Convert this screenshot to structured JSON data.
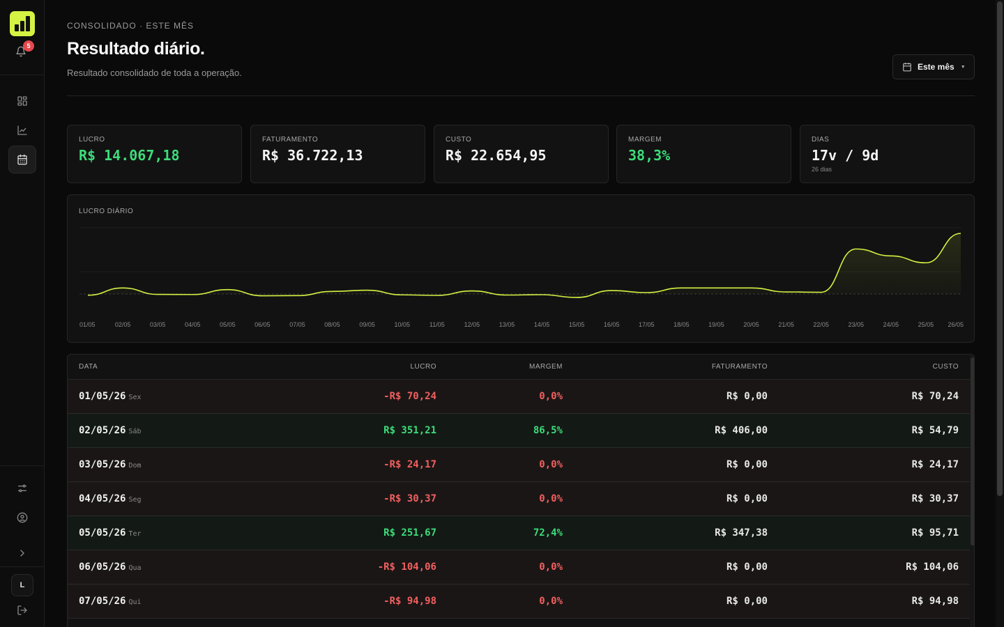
{
  "sidebar": {
    "notifications_count": "5",
    "avatar_initial": "L"
  },
  "header": {
    "eyebrow": "CONSOLIDADO · ESTE MÊS",
    "title": "Resultado diário.",
    "subtitle": "Resultado consolidado de toda a operação.",
    "period_button": "Este mês"
  },
  "kpis": [
    {
      "label": "LUCRO",
      "value": "R$ 14.067,18",
      "accent": "#3ddc7a"
    },
    {
      "label": "FATURAMENTO",
      "value": "R$ 36.722,13"
    },
    {
      "label": "CUSTO",
      "value": "R$ 22.654,95"
    },
    {
      "label": "MARGEM",
      "value": "38,3%",
      "accent": "#3ddc7a"
    },
    {
      "label": "DIAS",
      "value": "17v / 9d",
      "sub": "26 dias"
    }
  ],
  "chart_title": "LUCRO DIÁRIO",
  "chart_data": {
    "type": "area",
    "title": "LUCRO DIÁRIO",
    "x": [
      "01/05",
      "02/05",
      "03/05",
      "04/05",
      "05/05",
      "06/05",
      "07/05",
      "08/05",
      "09/05",
      "10/05",
      "11/05",
      "12/05",
      "13/05",
      "14/05",
      "15/05",
      "16/05",
      "17/05",
      "18/05",
      "19/05",
      "20/05",
      "21/05",
      "22/05",
      "23/05",
      "24/05",
      "25/05",
      "26/05"
    ],
    "series": [
      {
        "values": [
          -70,
          351,
          -24,
          -30,
          252,
          -104,
          -95,
          150,
          220,
          -50,
          -80,
          180,
          -60,
          -40,
          -200,
          200,
          80,
          350,
          350,
          350,
          120,
          100,
          2600,
          2200,
          1800,
          3500
        ]
      }
    ],
    "baseline": 0,
    "color": "#d4f243",
    "grid": true
  },
  "table": {
    "headers": {
      "data": "DATA",
      "lucro": "LUCRO",
      "margem": "MARGEM",
      "faturamento": "FATURAMENTO",
      "custo": "CUSTO"
    },
    "rows": [
      {
        "date": "01/05/26",
        "dow": "Sex",
        "lucro": "-R$ 70,24",
        "margem": "0,0%",
        "faturamento": "R$ 0,00",
        "custo": "R$ 70,24",
        "positive": false
      },
      {
        "date": "02/05/26",
        "dow": "Sáb",
        "lucro": "R$ 351,21",
        "margem": "86,5%",
        "faturamento": "R$ 406,00",
        "custo": "R$ 54,79",
        "positive": true
      },
      {
        "date": "03/05/26",
        "dow": "Dom",
        "lucro": "-R$ 24,17",
        "margem": "0,0%",
        "faturamento": "R$ 0,00",
        "custo": "R$ 24,17",
        "positive": false
      },
      {
        "date": "04/05/26",
        "dow": "Seg",
        "lucro": "-R$ 30,37",
        "margem": "0,0%",
        "faturamento": "R$ 0,00",
        "custo": "R$ 30,37",
        "positive": false
      },
      {
        "date": "05/05/26",
        "dow": "Ter",
        "lucro": "R$ 251,67",
        "margem": "72,4%",
        "faturamento": "R$ 347,38",
        "custo": "R$ 95,71",
        "positive": true
      },
      {
        "date": "06/05/26",
        "dow": "Qua",
        "lucro": "-R$ 104,06",
        "margem": "0,0%",
        "faturamento": "R$ 0,00",
        "custo": "R$ 104,06",
        "positive": false
      },
      {
        "date": "07/05/26",
        "dow": "Qui",
        "lucro": "-R$ 94,98",
        "margem": "0,0%",
        "faturamento": "R$ 0,00",
        "custo": "R$ 94,98",
        "positive": false
      }
    ]
  }
}
